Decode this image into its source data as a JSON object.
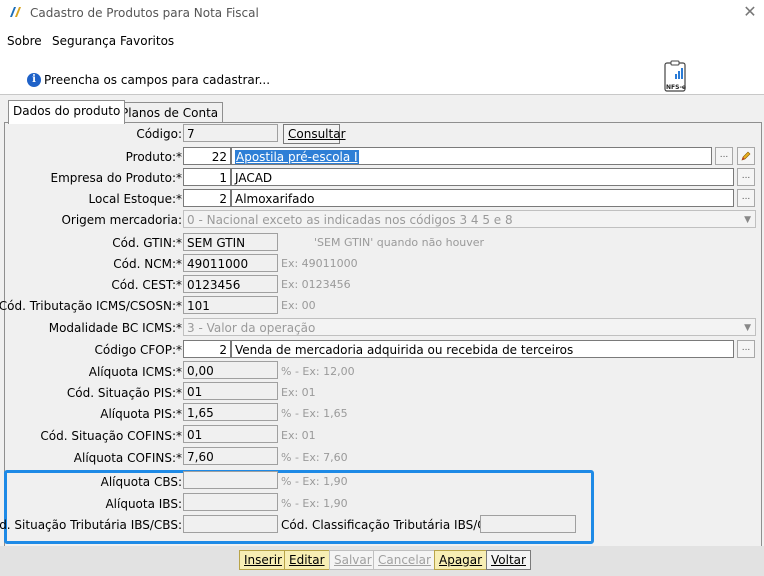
{
  "window": {
    "title": "Cadastro de Produtos para Nota Fiscal",
    "close": "✕"
  },
  "menu": [
    "Sobre",
    "Segurança",
    "Favoritos"
  ],
  "banner": {
    "message": "Preencha os campos para cadastrar..."
  },
  "tabs": [
    "Dados do produto",
    "Planos de Conta"
  ],
  "form": {
    "codigo": {
      "label": "Código:",
      "value": "7",
      "button": "Consultar"
    },
    "produto": {
      "label": "Produto:*",
      "code": "22",
      "value": "Apostila pré-escola I"
    },
    "empresa": {
      "label": "Empresa do Produto:*",
      "code": "1",
      "value": "JACAD"
    },
    "local": {
      "label": "Local Estoque:*",
      "code": "2",
      "value": "Almoxarifado"
    },
    "origem": {
      "label": "Origem mercadoria:",
      "value": "0 - Nacional exceto as indicadas nos códigos 3 4 5 e 8"
    },
    "gtin": {
      "label": "Cód. GTIN:*",
      "value": "SEM GTIN",
      "hint": "'SEM GTIN' quando não houver"
    },
    "ncm": {
      "label": "Cód. NCM:*",
      "value": "49011000",
      "hint": "Ex: 49011000"
    },
    "cest": {
      "label": "Cód. CEST:*",
      "value": "0123456",
      "hint": "Ex: 0123456"
    },
    "icms_csosn": {
      "label": "Cód. Tributação ICMS/CSOSN:*",
      "value": "101",
      "hint": "Ex: 00"
    },
    "modalidade": {
      "label": "Modalidade BC ICMS:*",
      "value": "3 - Valor da operação"
    },
    "cfop": {
      "label": "Código CFOP:*",
      "code": "2",
      "value": "Venda de mercadoria adquirida ou recebida de terceiros"
    },
    "aliq_icms": {
      "label": "Alíquota ICMS:*",
      "value": "0,00",
      "hint": "% - Ex: 12,00"
    },
    "sit_pis": {
      "label": "Cód. Situação PIS:*",
      "value": "01",
      "hint": "Ex: 01"
    },
    "aliq_pis": {
      "label": "Alíquota PIS:*",
      "value": "1,65",
      "hint": "% - Ex: 1,65"
    },
    "sit_cofins": {
      "label": "Cód. Situação COFINS:*",
      "value": "01",
      "hint": "Ex: 01"
    },
    "aliq_cofins": {
      "label": "Alíquota COFINS:*",
      "value": "7,60",
      "hint": "% - Ex: 7,60"
    },
    "aliq_cbs": {
      "label": "Alíquota CBS:",
      "value": "",
      "hint": "% - Ex: 1,90"
    },
    "aliq_ibs": {
      "label": "Alíquota IBS:",
      "value": "",
      "hint": "% - Ex: 1,90"
    },
    "sit_ibs_cbs": {
      "label": "Cód. Situação Tributária IBS/CBS:",
      "value": ""
    },
    "class_ibs_cbs": {
      "label": "Cód. Classificação Tributária IBS/CBS:",
      "value": ""
    }
  },
  "buttons": [
    "Inserir",
    "Editar",
    "Salvar",
    "Cancelar",
    "Apagar",
    "Voltar"
  ],
  "ellipsis": "..."
}
